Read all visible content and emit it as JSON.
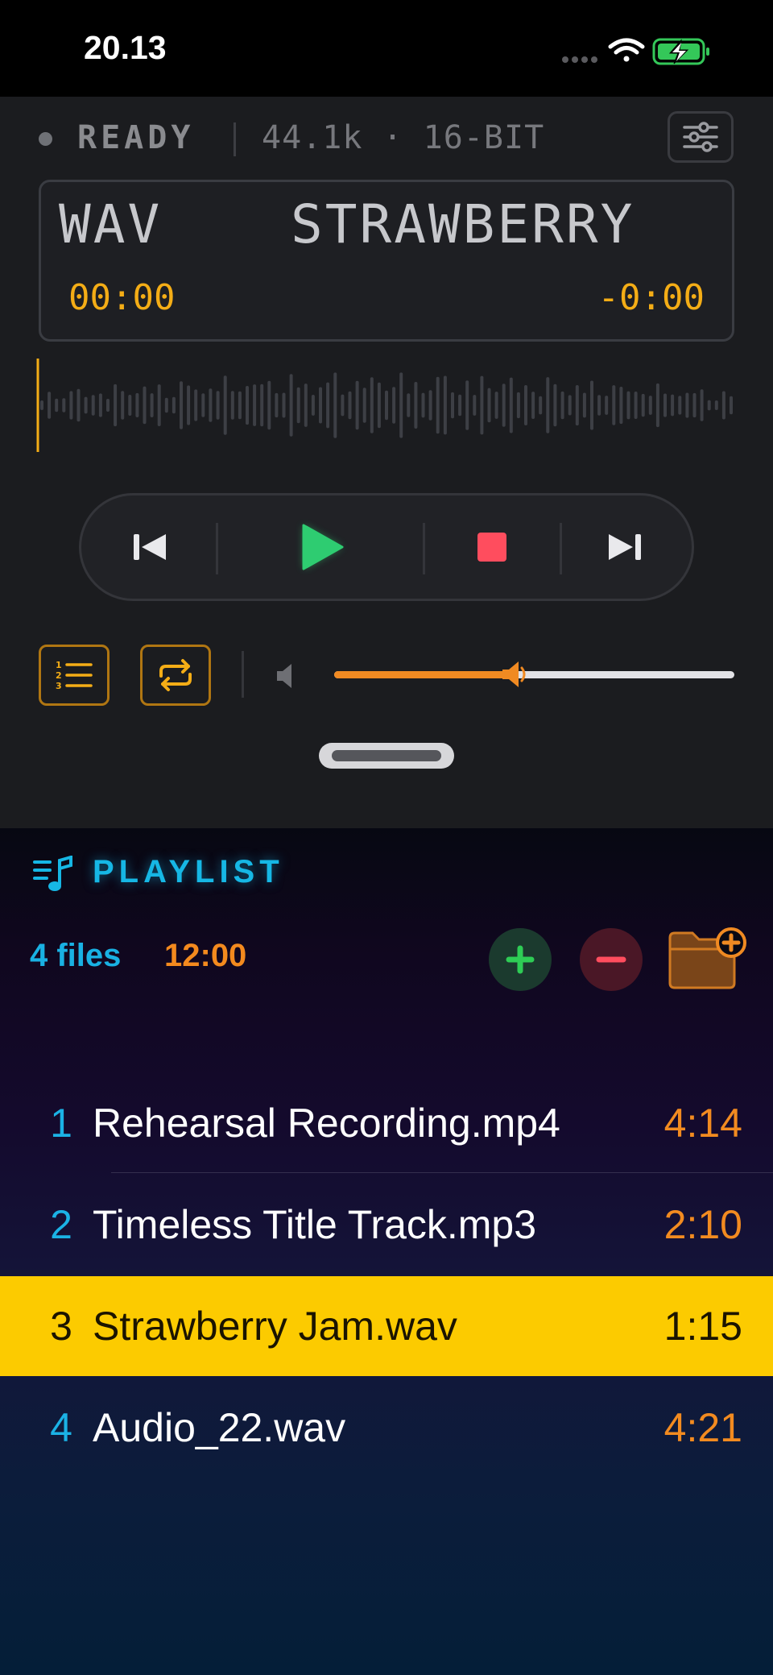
{
  "status_bar": {
    "time": "20.13",
    "icons": [
      "cellular-dots-icon",
      "wifi-icon",
      "battery-charging-icon"
    ]
  },
  "player": {
    "state_label": "READY",
    "format_info": "44.1k · 16-BIT",
    "display": {
      "marquee_left": "WAV",
      "marquee_main": "STRAWBERRY",
      "elapsed": "00:00",
      "remaining": "-0:00"
    },
    "playback_progress": 0.0,
    "transport": [
      "previous-icon",
      "play-icon",
      "stop-icon",
      "next-icon"
    ],
    "volume_level": 0.44,
    "colors": {
      "accent": "#f4ad16",
      "play": "#2ecc71",
      "stop": "#ff4d5e",
      "volume": "#f08a22"
    }
  },
  "playlist": {
    "title": "PLAYLIST",
    "files_count": "4 files",
    "total_duration": "12:00",
    "tracks": [
      {
        "number": "1",
        "name": "Rehearsal Recording.mp4",
        "duration": "4:14",
        "selected": false
      },
      {
        "number": "2",
        "name": "Timeless Title Track.mp3",
        "duration": "2:10",
        "selected": false
      },
      {
        "number": "3",
        "name": "Strawberry Jam.wav",
        "duration": "1:15",
        "selected": true
      },
      {
        "number": "4",
        "name": "Audio_22.wav",
        "duration": "4:21",
        "selected": false
      }
    ],
    "colors": {
      "number": "#1bb2e5",
      "duration": "#f28b20",
      "selected_row": "#fccb00"
    }
  }
}
